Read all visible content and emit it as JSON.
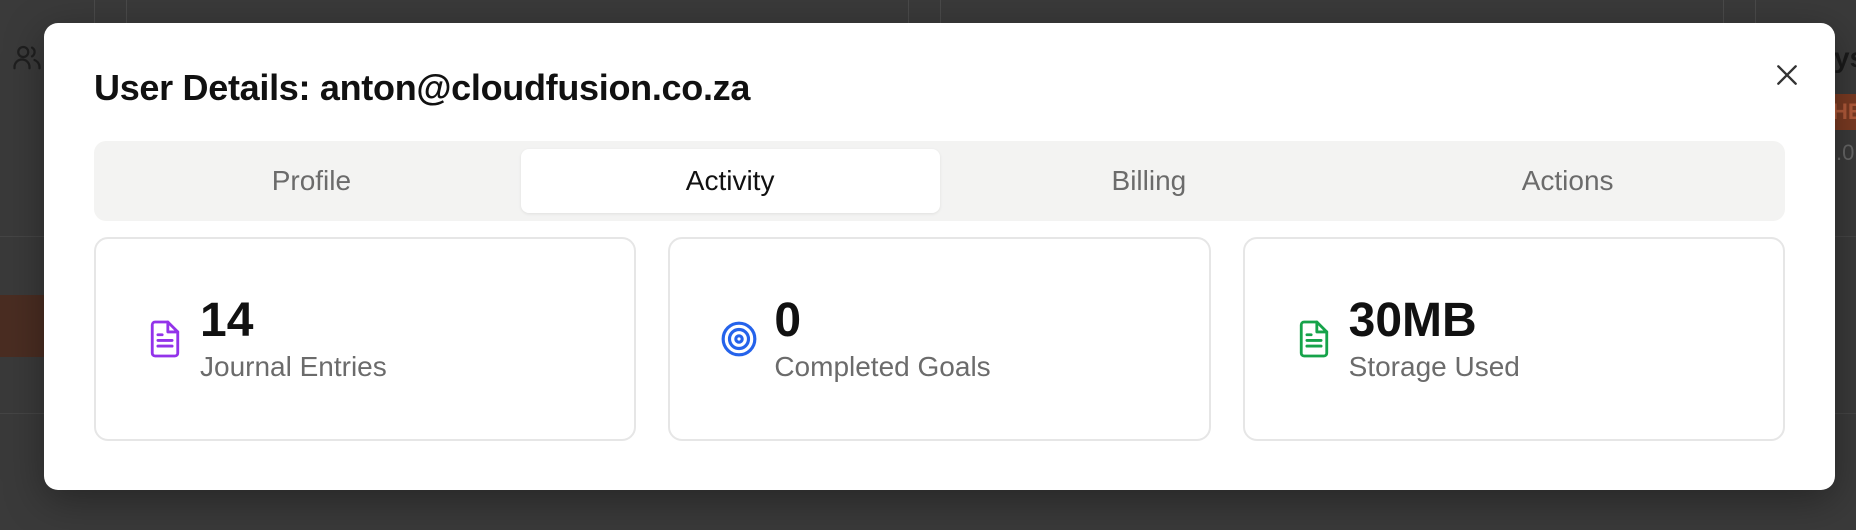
{
  "modal": {
    "title": "User Details: anton@cloudfusion.co.za"
  },
  "tabs": [
    {
      "label": "Profile",
      "active": false
    },
    {
      "label": "Activity",
      "active": true
    },
    {
      "label": "Billing",
      "active": false
    },
    {
      "label": "Actions",
      "active": false
    }
  ],
  "stats": [
    {
      "value": "14",
      "label": "Journal Entries",
      "icon": "file-text-icon",
      "color": "#9333ea"
    },
    {
      "value": "0",
      "label": "Completed Goals",
      "icon": "target-icon",
      "color": "#2563eb"
    },
    {
      "value": "30MB",
      "label": "Storage Used",
      "icon": "file-text-icon",
      "color": "#16a34a"
    }
  ],
  "background": {
    "right_text": "ys",
    "right_badge": "HE",
    "right_sub": ".0"
  }
}
